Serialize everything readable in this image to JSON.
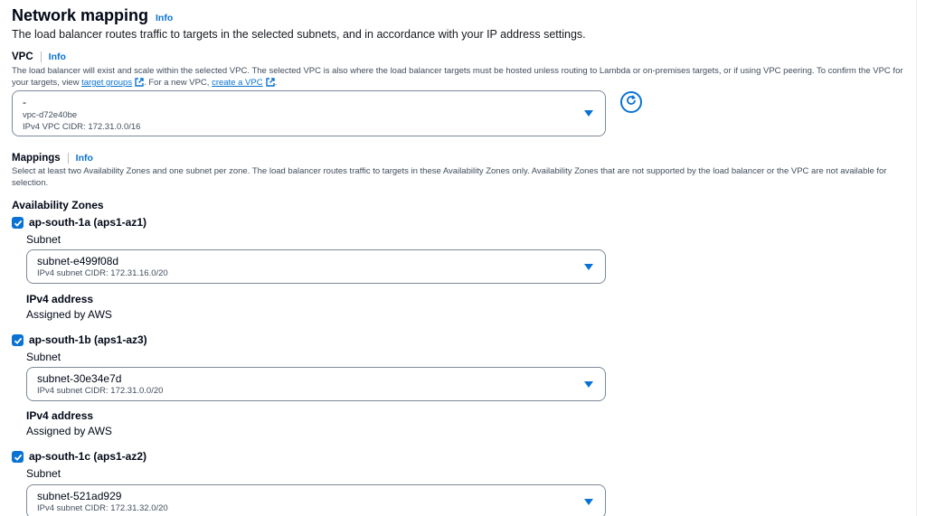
{
  "section": {
    "title": "Network mapping",
    "info": "Info",
    "description": "The load balancer routes traffic to targets in the selected subnets, and in accordance with your IP address settings."
  },
  "vpc": {
    "label": "VPC",
    "info": "Info",
    "help_prefix": "The load balancer will exist and scale within the selected VPC. The selected VPC is also where the load balancer targets must be hosted unless routing to Lambda or on-premises targets, or if using VPC peering. To confirm the VPC for your targets, view ",
    "target_groups_link": "target groups",
    "help_middle": ". For a new VPC, ",
    "create_vpc_link": "create a VPC",
    "help_suffix": ".",
    "selected_name": "-",
    "selected_id": "vpc-d72e40be",
    "selected_cidr": "IPv4 VPC CIDR: 172.31.0.0/16"
  },
  "mappings": {
    "label": "Mappings",
    "info": "Info",
    "description": "Select at least two Availability Zones and one subnet per zone. The load balancer routes traffic to targets in these Availability Zones only. Availability Zones that are not supported by the load balancer or the VPC are not available for selection.",
    "az_heading": "Availability Zones",
    "zones": [
      {
        "name": "ap-south-1a (aps1-az1)",
        "checked": true,
        "subnet_label": "Subnet",
        "subnet_id": "subnet-e499f08d",
        "subnet_cidr": "IPv4 subnet CIDR: 172.31.16.0/20",
        "ipv4_label": "IPv4 address",
        "ipv4_value": "Assigned by AWS"
      },
      {
        "name": "ap-south-1b (aps1-az3)",
        "checked": true,
        "subnet_label": "Subnet",
        "subnet_id": "subnet-30e34e7d",
        "subnet_cidr": "IPv4 subnet CIDR: 172.31.0.0/20",
        "ipv4_label": "IPv4 address",
        "ipv4_value": "Assigned by AWS"
      },
      {
        "name": "ap-south-1c (aps1-az2)",
        "checked": true,
        "subnet_label": "Subnet",
        "subnet_id": "subnet-521ad929",
        "subnet_cidr": "IPv4 subnet CIDR: 172.31.32.0/20"
      }
    ]
  },
  "colors": {
    "link": "#0972d3",
    "border": "#7d8998",
    "text": "#000716",
    "secondary_text": "#414d5c"
  },
  "icons": {
    "refresh": "refresh-icon",
    "external": "external-link-icon",
    "caret": "caret-down-icon",
    "check": "checkmark-icon"
  }
}
